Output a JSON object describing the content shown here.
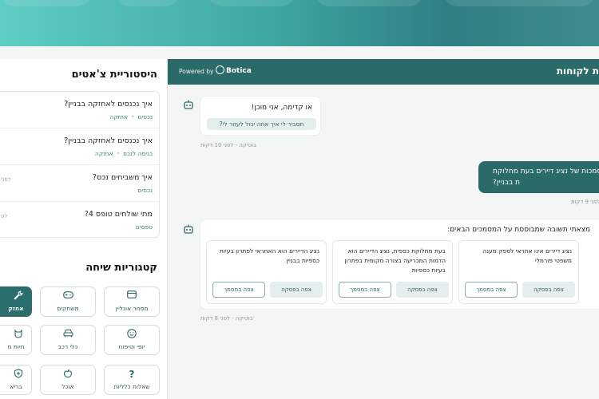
{
  "sidebar": {
    "history_title": "היסטוריית צ'אטים",
    "history": [
      {
        "question": "איך נכנסים לאחזקה בבניין?",
        "tags": [
          "נכסים",
          "אחזקה"
        ],
        "time": ""
      },
      {
        "question": "איך נכנסים לאחזקה בבניין?",
        "tags": [
          "כניסה לנכס",
          "אחזקה"
        ],
        "time": ""
      },
      {
        "question": "איך משביחים נכס?",
        "tags": [
          "נכסים"
        ],
        "time": "לפני"
      },
      {
        "question": "מתי שולחים טופס 4?",
        "tags": [
          "טפסים"
        ],
        "time": "לפ"
      }
    ],
    "categories_title": "קטגוריות שיחה",
    "categories": [
      {
        "label": "מסחר אונליין",
        "icon": "credit-card-icon"
      },
      {
        "label": "משחקים",
        "icon": "gamepad-icon"
      },
      {
        "label": "אחזק",
        "icon": "wrench-icon",
        "active": true
      },
      {
        "label": "יופי וטיפוח",
        "icon": "smiley-icon"
      },
      {
        "label": "כלי רכב",
        "icon": "car-icon"
      },
      {
        "label": "חיות מ",
        "icon": "pet-icon"
      },
      {
        "label": "שאלות כלליות",
        "icon": "question-icon"
      },
      {
        "label": "אוכל",
        "icon": "apple-icon"
      },
      {
        "label": "בריא",
        "icon": "shield-plus-icon"
      }
    ]
  },
  "chat": {
    "powered_by": "Powered by",
    "brand": "Botica",
    "title": "ת לקוחות",
    "messages": {
      "greeting": {
        "text": "או קדימה, אני מוכן!",
        "suggestion": "תסביר לי איך אתה יכול לעזור לי?",
        "meta": "בוטיקה - לפני 10 דקות"
      },
      "user": {
        "line1": "סמכות של נציג דיירים בעת מחלוקת",
        "line2": "ת בבניין?",
        "meta": "לפני 9 דקות"
      },
      "answer": {
        "intro": "מצאתי תשובה שמבוססת על המסמכים הבאים:",
        "meta": "בוטיקה - לפני 8 דקות",
        "documents": [
          {
            "text": "נציג דיירים אינו אחראי לספק מענה משפטי פורמלי",
            "view_chat": "צפה בפסקה",
            "view_doc": "צפה במסמך"
          },
          {
            "text": "בעת מחלוקת כספית, נציג הדיירים הוא הדמות המכריעה בצורה מקומית בפתרון בעיות כספיות",
            "view_chat": "צפה בפסקה",
            "view_doc": "צפה במסמך"
          },
          {
            "text": "נציג הדיירים הוא האחראי לפתרון בעיות כספיות בבניין",
            "view_chat": "צפה בפסקה",
            "view_doc": "צפה במסמך"
          }
        ]
      }
    }
  },
  "colors": {
    "primary": "#2a6a69",
    "accent_tag": "#2c8a75",
    "banner_start": "#5ecdc2",
    "banner_end": "#2f7f84"
  }
}
